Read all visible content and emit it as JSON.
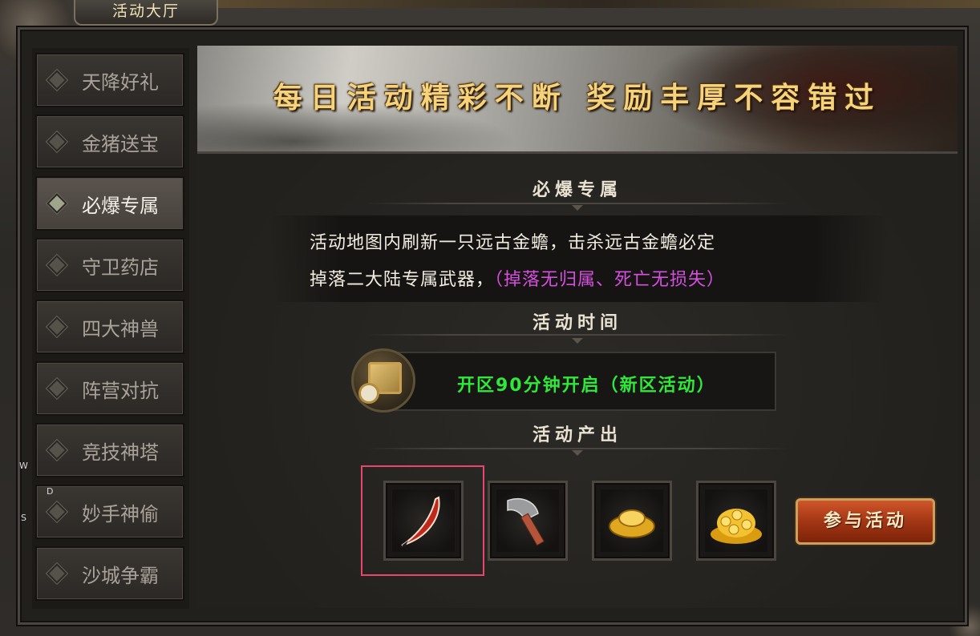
{
  "window": {
    "title": "活动大厅"
  },
  "sidebar": {
    "items": [
      {
        "label": "天降好礼",
        "active": false
      },
      {
        "label": "金猪送宝",
        "active": false
      },
      {
        "label": "必爆专属",
        "active": true
      },
      {
        "label": "守卫药店",
        "active": false
      },
      {
        "label": "四大神兽",
        "active": false
      },
      {
        "label": "阵营对抗",
        "active": false
      },
      {
        "label": "竞技神塔",
        "active": false
      },
      {
        "label": "妙手神偷",
        "active": false
      },
      {
        "label": "沙城争霸",
        "active": false
      }
    ]
  },
  "banner": {
    "text": "每日活动精彩不断  奖励丰厚不容错过"
  },
  "section1": {
    "title": "必爆专属",
    "line1": "活动地图内刷新一只远古金蟾，击杀远古金蟾必定",
    "line2_main": "掉落二大陆专属武器，",
    "line2_note": "（掉落无归属、死亡无损失）"
  },
  "section2": {
    "title": "活动时间",
    "time_text": "开区90分钟开启（新区活动）"
  },
  "section3": {
    "title": "活动产出",
    "rewards": [
      {
        "icon": "red-curved-blade-icon"
      },
      {
        "icon": "axe-icon"
      },
      {
        "icon": "gold-ingot-icon"
      },
      {
        "icon": "gold-coins-pile-icon"
      }
    ]
  },
  "join_button": {
    "label": "参与活动"
  },
  "keys": {
    "w": "W",
    "d": "D",
    "s": "S"
  },
  "colors": {
    "accent_gold": "#f6d37a",
    "time_green": "#2fe83a",
    "note_purple": "#d64fe0",
    "button_red": "#a23615",
    "highlight": "#e8466a"
  }
}
